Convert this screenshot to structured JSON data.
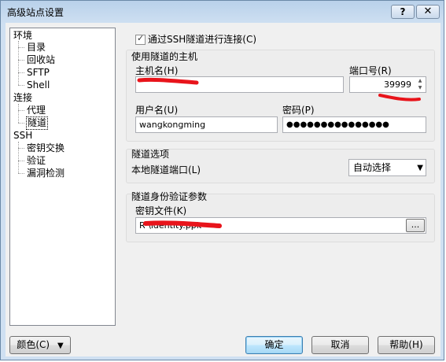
{
  "window": {
    "title": "高级站点设置",
    "help_glyph": "?",
    "close_glyph": "✕"
  },
  "tree": {
    "items": [
      {
        "label": "环境"
      },
      {
        "label": "目录"
      },
      {
        "label": "回收站"
      },
      {
        "label": "SFTP"
      },
      {
        "label": "Shell"
      },
      {
        "label": "连接"
      },
      {
        "label": "代理"
      },
      {
        "label": "隧道"
      },
      {
        "label": "SSH"
      },
      {
        "label": "密钥交换"
      },
      {
        "label": "验证"
      },
      {
        "label": "漏洞检测"
      }
    ]
  },
  "tunnel": {
    "checkbox_label": "通过SSH隧道进行连接(C)",
    "checked": true,
    "host_group_label": "使用隧道的主机",
    "hostname_label": "主机名(H)",
    "hostname_value": "",
    "port_label": "端口号(R)",
    "port_value": "39999",
    "username_label": "用户名(U)",
    "username_value": "wangkongming",
    "password_label": "密码(P)",
    "password_value": "●●●●●●●●●●●●●●●",
    "options_group_label": "隧道选项",
    "local_port_label": "本地隧道端口(L)",
    "local_port_value": "自动选择",
    "auth_group_label": "隧道身份验证参数",
    "keyfile_label": "密钥文件(K)",
    "keyfile_value": "R                   \\identity.ppk",
    "browse_label": "..."
  },
  "buttons": {
    "color": "颜色(C)",
    "ok": "确定",
    "cancel": "取消",
    "help": "帮助(H)"
  },
  "colors": {
    "redaction": "#e8141b"
  }
}
